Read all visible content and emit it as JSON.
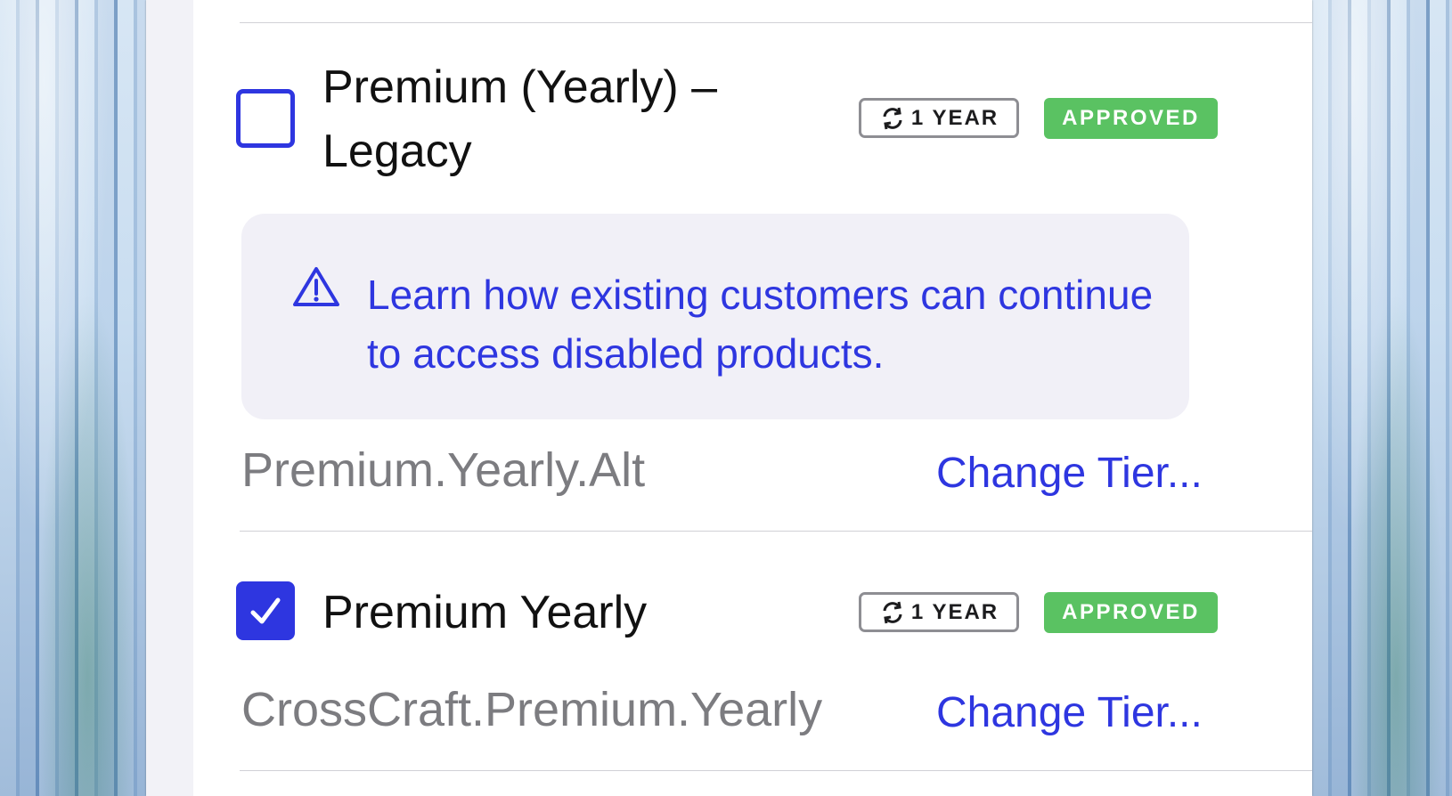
{
  "products": [
    {
      "name_line1": "Premium (Yearly) –",
      "name_line2": "Legacy",
      "checked": false,
      "duration": "1 YEAR",
      "status": "APPROVED",
      "notice": "Learn how existing customers can continue to access disabled products.",
      "product_id": "Premium.Yearly.Alt",
      "change_tier_label": "Change Tier..."
    },
    {
      "name": "Premium Yearly",
      "checked": true,
      "duration": "1 YEAR",
      "status": "APPROVED",
      "product_id": "CrossCraft.Premium.Yearly",
      "change_tier_label": "Change Tier..."
    }
  ],
  "colors": {
    "accent": "#2e36e0",
    "approved": "#5ac262",
    "secondary_text": "#7c7c80",
    "notice_bg": "#f1f0f7"
  },
  "icons": {
    "renew": "renew-icon",
    "warning": "warning-triangle-icon",
    "checkmark": "checkmark-icon"
  }
}
